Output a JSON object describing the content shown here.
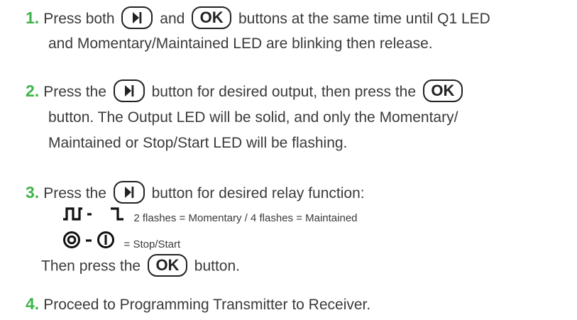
{
  "steps": [
    {
      "number": "1.",
      "line1": {
        "a": "Press both",
        "b": "and",
        "c": "buttons at the same time until Q1 LED"
      },
      "line2": "and Momentary/Maintained LED are blinking then release."
    },
    {
      "number": "2.",
      "line1": {
        "a": "Press the",
        "b": "button for desired output, then press the"
      },
      "line2": "button. The Output LED will be solid, and only the Momentary/",
      "line3": "Maintained or Stop/Start LED will be flashing."
    },
    {
      "number": "3.",
      "line1": {
        "a": "Press the",
        "b": "button for desired relay function:"
      },
      "option1": "2 flashes = Momentary / 4 flashes = Maintained",
      "option2": "= Stop/Start",
      "then": {
        "a": "Then press the",
        "b": "button."
      }
    },
    {
      "number": "4.",
      "text": "Proceed to Programming Transmitter to Receiver."
    }
  ],
  "buttons": {
    "ok_label": "OK"
  },
  "icons": {
    "arrow_button": "next-arrow-icon",
    "pulse": "momentary-pulse-icon",
    "step": "maintained-step-icon",
    "stop": "stop-icon",
    "start": "start-icon"
  },
  "colors": {
    "step_number": "#3db54a",
    "text": "#3a3a3a",
    "button_outline": "#222222"
  }
}
